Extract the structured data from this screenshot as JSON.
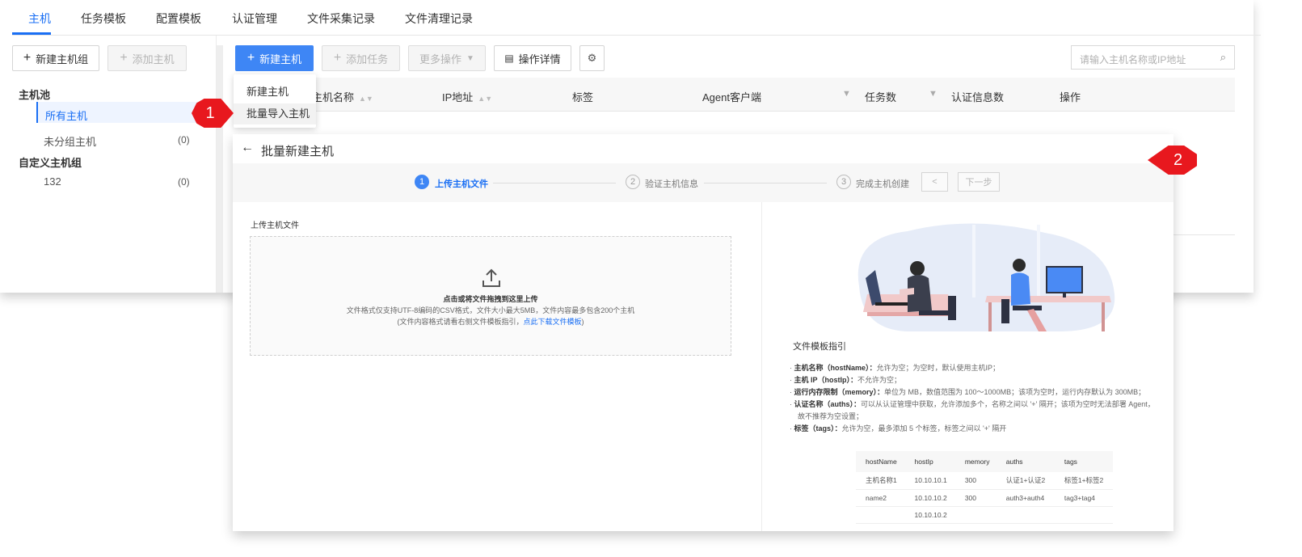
{
  "tabs": [
    "主机",
    "任务模板",
    "配置模板",
    "认证管理",
    "文件采集记录",
    "文件清理记录"
  ],
  "left_toolbar": {
    "new_group": "新建主机组",
    "add_host": "添加主机"
  },
  "tree": {
    "pool_title": "主机池",
    "all_hosts": "所有主机",
    "ungrouped": "未分组主机",
    "ungrouped_count": "(0)",
    "custom_title": "自定义主机组",
    "group_name": "132",
    "group_count": "(0)"
  },
  "toolbar": {
    "new_host": "新建主机",
    "add_task": "添加任务",
    "more_ops": "更多操作",
    "op_details": "操作详情",
    "search_placeholder": "请输入主机名称或IP地址"
  },
  "table_headers": [
    "主机名称",
    "IP地址",
    "标签",
    "Agent客户端",
    "任务数",
    "认证信息数",
    "操作"
  ],
  "dropdown": [
    "新建主机",
    "批量导入主机"
  ],
  "callouts": [
    "1",
    "2"
  ],
  "import_page": {
    "title": "批量新建主机",
    "steps": [
      {
        "num": "1",
        "label": "上传主机文件"
      },
      {
        "num": "2",
        "label": "验证主机信息"
      },
      {
        "num": "3",
        "label": "完成主机创建"
      }
    ],
    "prev_label": "<",
    "next_label": "下一步",
    "upload_label": "上传主机文件",
    "dz_main": "点击或将文件拖拽到这里上传",
    "dz_line2": "文件格式仅支持UTF-8编码的CSV格式，文件大小最大5MB，文件内容最多包含200个主机",
    "dz_line3_pre": "(文件内容格式请看右侧文件模板指引，",
    "dz_line3_link": "点此下载文件模板",
    "dz_line3_post": ")",
    "guide_title": "文件模板指引",
    "guide": [
      {
        "key": "主机名称（hostName）：",
        "text": "允许为空；为空时，默认使用主机IP；"
      },
      {
        "key": "主机 IP（hostIp）：",
        "text": "不允许为空；"
      },
      {
        "key": "运行内存限制（memory）：",
        "text": "单位为 MB，数值范围为 100～1000MB；该项为空时，运行内存默认为 300MB；"
      },
      {
        "key": "认证名称（auths）：",
        "text": "可以从认证管理中获取，允许添加多个，名称之间以 '+' 隔开；该项为空时无法部署 Agent，"
      },
      {
        "key": "",
        "text": "故不推荐为空设置；"
      },
      {
        "key": "标签（tags）：",
        "text": "允许为空，最多添加 5 个标签，标签之间以 '+' 隔开"
      }
    ],
    "tpl_headers": [
      "hostName",
      "hostIp",
      "memory",
      "auths",
      "tags"
    ],
    "tpl_rows": [
      [
        "主机名称1",
        "10.10.10.1",
        "300",
        "认证1+认证2",
        "标签1+标签2"
      ],
      [
        "name2",
        "10.10.10.2",
        "300",
        "auth3+auth4",
        "tag3+tag4"
      ],
      [
        "",
        "10.10.10.2",
        "",
        "",
        ""
      ]
    ]
  },
  "colors": {
    "primary": "#3e86f5",
    "callout": "#e8181e"
  }
}
